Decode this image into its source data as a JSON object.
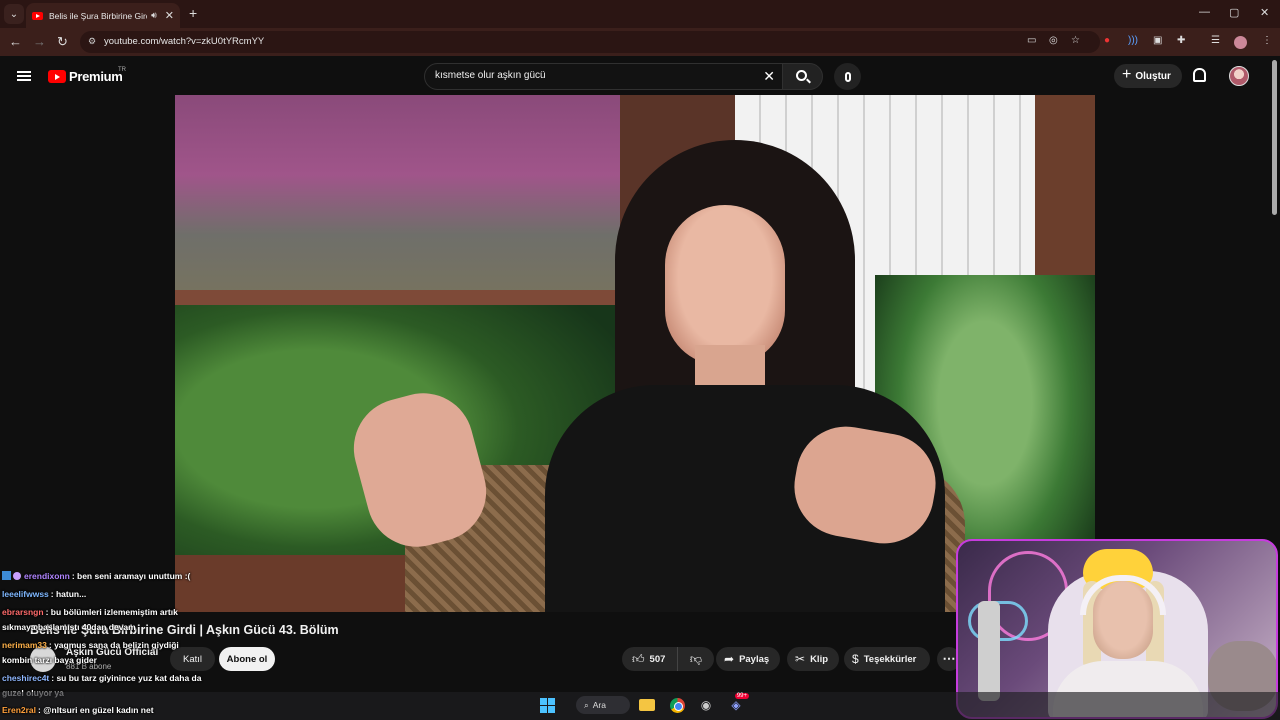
{
  "browser": {
    "tab_title": "Belis ile Şura Birbirine Girdi",
    "tab_audio_icon": "speaker-icon",
    "tab_close": "✕",
    "new_tab": "+",
    "url": "youtube.com/watch?v=zkU0tYRcmYY",
    "window_controls": [
      "—",
      "▢",
      "✕"
    ],
    "nav": [
      "←",
      "→",
      "↻"
    ]
  },
  "youtube": {
    "brand": "Premium",
    "region": "TR",
    "search_query": "kısmetse olur aşkın gücü",
    "create_label": "Oluştur"
  },
  "video": {
    "title": "Belis ile Şura Birbirine Girdi | Aşkın Gücü 43. Bölüm",
    "channel": "Aşkın Gücü Official",
    "subscribers": "881 B abone",
    "join_label": "Katıl",
    "subscribe_label": "Abone ol",
    "likes": "507",
    "share_label": "Paylaş",
    "clip_label": "Klip",
    "thanks_label": "Teşekkürler",
    "more": "⋯"
  },
  "chat": [
    {
      "user": "erendixonn",
      "color": "#b084ff",
      "text": ": ben seni aramayı unuttum :(",
      "badges": true
    },
    {
      "user": "leeelifwwss",
      "color": "#7fb8ff",
      "text": ": hatun..."
    },
    {
      "user": "ebrarsngn",
      "color": "#ff6b6b",
      "text": ": bu bölümleri izlememiştim artık"
    },
    {
      "user": "",
      "color": "#fff",
      "text": "sıkmaya başlamıştı 40dan devam"
    },
    {
      "user": "nerimam33",
      "color": "#ffb24a",
      "text": ": yagmus sana da belizin giydiği"
    },
    {
      "user": "",
      "color": "#fff",
      "text": "kombin tarzı baya gider"
    },
    {
      "user": "cheshirec4t",
      "color": "#8fb7ff",
      "text": ": su bu tarz giyinince yuz kat daha da"
    },
    {
      "user": "",
      "color": "#fff",
      "text": "guzel oluyor ya"
    },
    {
      "user": "Eren2ral",
      "color": "#ff9f3a",
      "text": ": @nltsuri en güzel kadın net"
    }
  ],
  "taskbar": {
    "search_label": "Ara",
    "discord_badge": "99+"
  }
}
